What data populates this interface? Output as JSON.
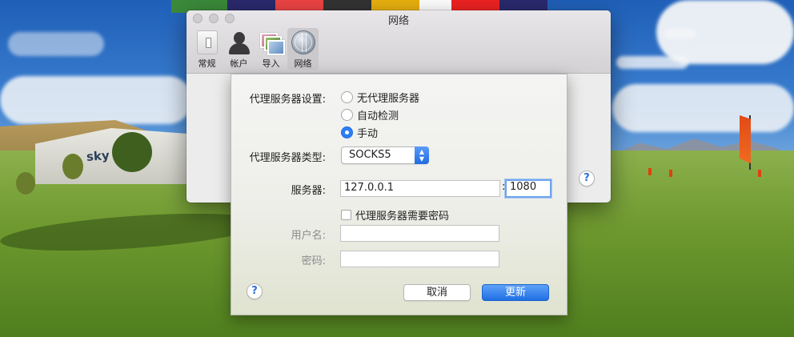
{
  "window": {
    "title": "网络",
    "toolbar": [
      {
        "label": "常规",
        "icon": "general-icon"
      },
      {
        "label": "帐户",
        "icon": "user-account-icon"
      },
      {
        "label": "导入",
        "icon": "import-photos-icon"
      },
      {
        "label": "网络",
        "icon": "network-globe-icon",
        "active": true
      }
    ],
    "help_label": "?"
  },
  "sheet": {
    "proxy_settings_label": "代理服务器设置:",
    "proxy_options": [
      {
        "label": "无代理服务器",
        "selected": false
      },
      {
        "label": "自动检测",
        "selected": false
      },
      {
        "label": "手动",
        "selected": true
      }
    ],
    "proxy_type_label": "代理服务器类型:",
    "proxy_type_value": "SOCKS5",
    "server_label": "服务器:",
    "server_host": "127.0.0.1",
    "server_port": "1080",
    "port_separator": ":",
    "requires_password_label": "代理服务器需要密码",
    "requires_password_checked": false,
    "username_label": "用户名:",
    "username_value": "",
    "password_label": "密码:",
    "password_value": "",
    "help_label": "?",
    "cancel_label": "取消",
    "update_label": "更新"
  },
  "colors": {
    "accent": "#2c7ef5",
    "primary_button": "#1f6fe4"
  }
}
